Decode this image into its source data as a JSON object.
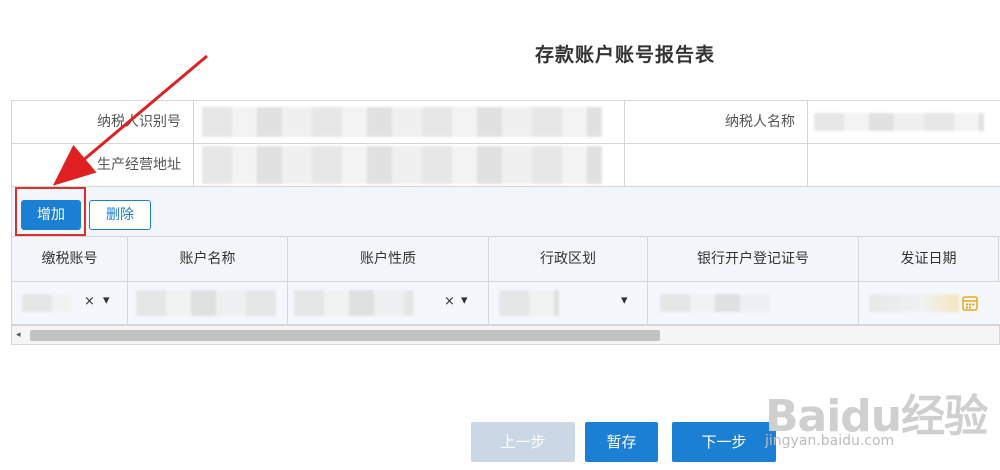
{
  "page": {
    "title": "存款账户账号报告表"
  },
  "info": {
    "taxpayer_id_label": "纳税人识别号",
    "taxpayer_name_label": "纳税人名称",
    "address_label": "生产经营地址"
  },
  "toolbar": {
    "add_label": "增加",
    "delete_label": "删除"
  },
  "grid": {
    "columns": [
      "缴税账号",
      "账户名称",
      "账户性质",
      "行政区划",
      "银行开户登记证号",
      "发证日期"
    ],
    "row": {
      "clear_glyph": "×",
      "dropdown_glyph": "▾"
    }
  },
  "scroll": {
    "left_glyph": "◂"
  },
  "footer": {
    "prev_label": "上一步",
    "save_label": "暂存",
    "next_label": "下一步"
  },
  "watermark": {
    "logo": "Baidu经验",
    "url": "jingyan.baidu.com"
  },
  "colors": {
    "primary": "#1b7fd4",
    "disabled": "#c9d8e4",
    "highlight": "#d93030",
    "header_bg": "#f2f6fb"
  }
}
